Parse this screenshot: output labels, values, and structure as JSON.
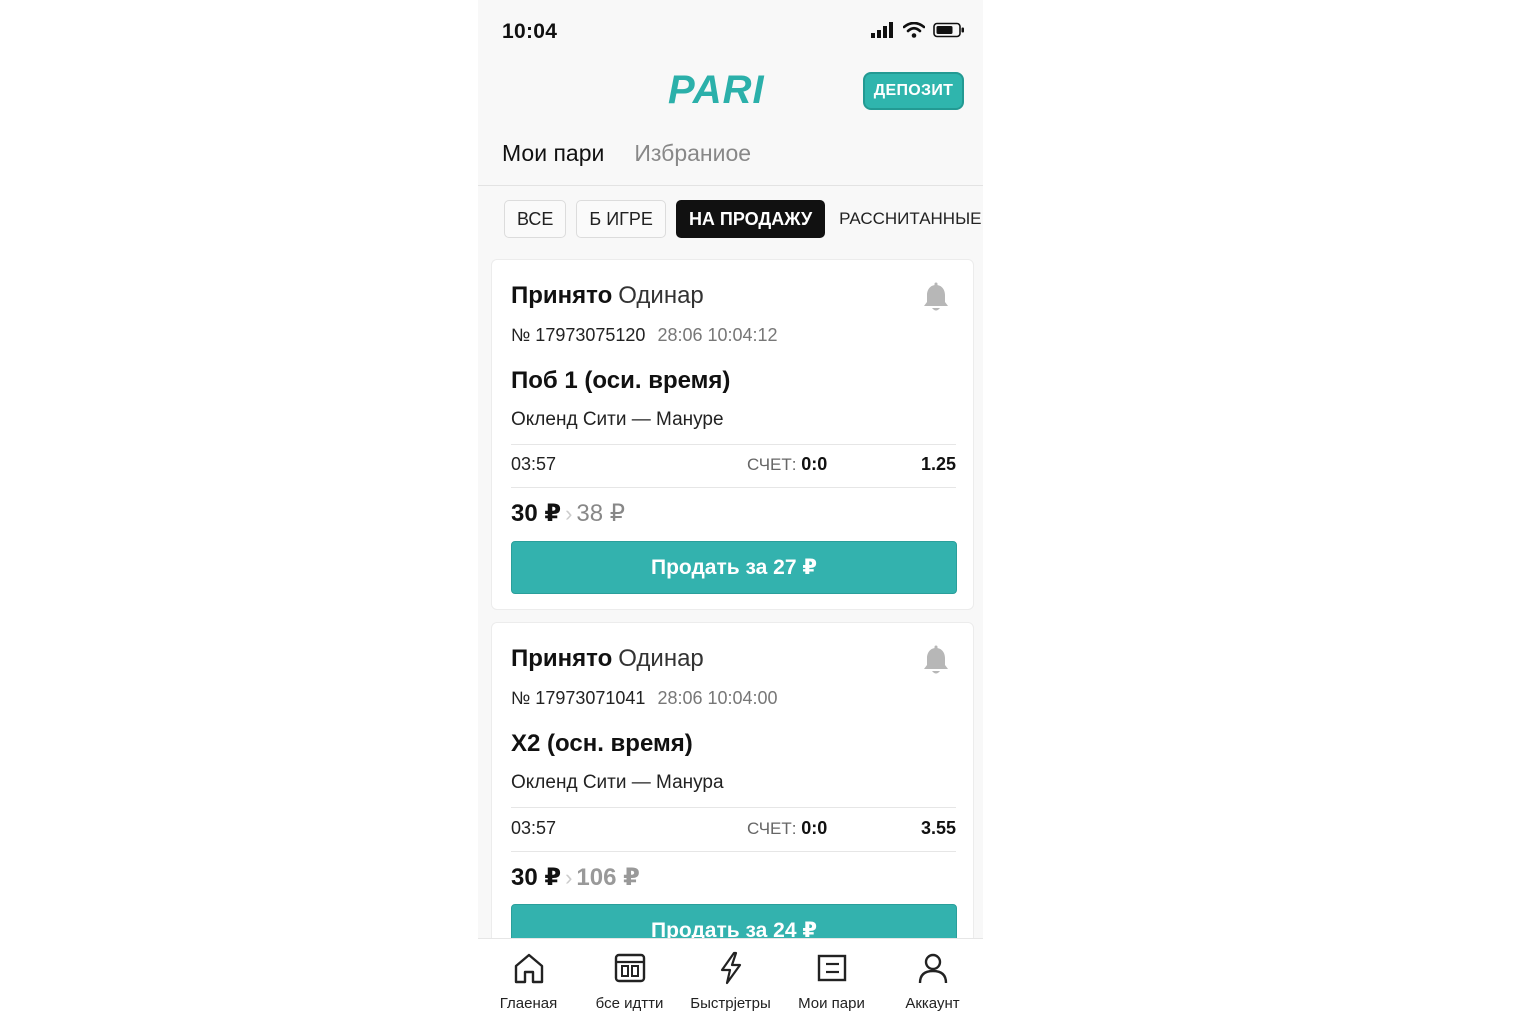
{
  "status_bar": {
    "time": "10:04"
  },
  "header": {
    "logo": "PARI",
    "deposit_label": "ДЕПОЗИТ"
  },
  "tabs": [
    {
      "label": "Мои пари",
      "active": true
    },
    {
      "label": "Избраниое",
      "active": false
    }
  ],
  "filters": [
    {
      "label": "ВСЕ"
    },
    {
      "label": "Б ИГРЕ"
    },
    {
      "label": "НА ПРОДАЖУ",
      "active": true
    },
    {
      "label": "РАССНИТАННЫЕ"
    }
  ],
  "bets": [
    {
      "status": "Принято",
      "type": "Одинар",
      "number": "№ 17973075120",
      "datetime": "28:06 10:04:12",
      "bet_name": "Поб 1 (оси. время)",
      "match": "Окленд Сити — Мануре",
      "time": "03:57",
      "score_label": "СЧЕТ:",
      "score": "0:0",
      "odds": "1.25",
      "stake": "30 ₽",
      "payout": "38 ₽",
      "sell_label": "Продать за 27 ₽"
    },
    {
      "status": "Принято",
      "type": "Одинар",
      "number": "№ 17973071041",
      "datetime": "28:06 10:04:00",
      "bet_name": "Х2 (осн. время)",
      "match": "Окленд Сити — Манура",
      "time": "03:57",
      "score_label": "СЧЕТ:",
      "score": "0:0",
      "odds": "3.55",
      "stake": "30 ₽",
      "payout": "106 ₽",
      "sell_label": "Продать за 24 ₽"
    }
  ],
  "bottom_nav": [
    {
      "label": "Глаеная",
      "icon": "home-icon"
    },
    {
      "label": "бсе идтти",
      "icon": "events-icon"
    },
    {
      "label": "Быстрјетры",
      "icon": "lightning-icon"
    },
    {
      "label": "Мои пари",
      "icon": "my-bets-icon"
    },
    {
      "label": "Аккаунт",
      "icon": "account-icon"
    }
  ],
  "colors": {
    "accent": "#2fb5ad",
    "active_filter": "#111111"
  }
}
